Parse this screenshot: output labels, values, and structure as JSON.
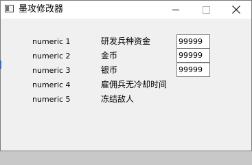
{
  "window": {
    "title": "墨攻修改器",
    "controls": {
      "minimize_icon": "minimize-icon",
      "maximize_icon": "maximize-icon",
      "close_icon": "close-icon"
    }
  },
  "rows": [
    {
      "numeric": "numeric 1",
      "label": "研发兵种资金",
      "value": "99999"
    },
    {
      "numeric": "numeric 2",
      "label": "金币",
      "value": "99999"
    },
    {
      "numeric": "numeric 3",
      "label": "银币",
      "value": "99999"
    },
    {
      "numeric": "numeric 4",
      "label": "雇佣兵无冷却时间"
    },
    {
      "numeric": "numeric 5",
      "label": "冻结敌人"
    }
  ]
}
